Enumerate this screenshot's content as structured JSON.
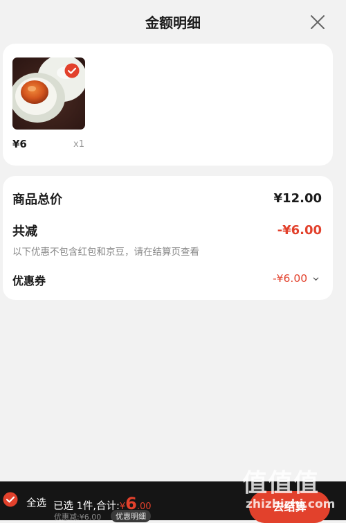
{
  "header": {
    "title": "金额明细"
  },
  "product": {
    "price": "¥6",
    "quantity": "x1"
  },
  "summary": {
    "total_label": "商品总价",
    "total_value": "¥12.00",
    "reduce_label": "共减",
    "reduce_value": "-¥6.00",
    "note": "以下优惠不包含红包和京豆，请在结算页查看",
    "coupon_label": "优惠券",
    "coupon_value": "-¥6.00"
  },
  "footer": {
    "select_all": "全选",
    "selected_text": "已选 1件,合计:",
    "currency": "¥",
    "amount_main": "6",
    "amount_cents": ".00",
    "discount_text": "优惠减:¥6.00",
    "detail_label": "优惠明细",
    "checkout_label": "去结算"
  },
  "watermark": {
    "top": "值值值",
    "bottom": "zhizhizhi.com"
  },
  "colors": {
    "accent": "#e2412c",
    "bar_bg": "#151515",
    "page_bg": "#f2f2f2"
  }
}
